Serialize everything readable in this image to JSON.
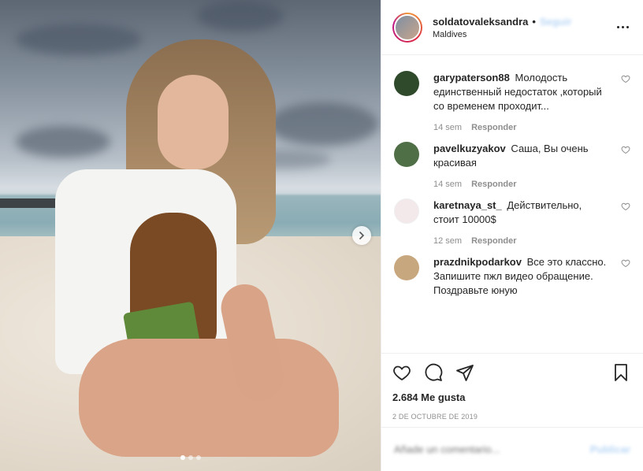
{
  "post": {
    "username": "soldatovaleksandra",
    "separator": "•",
    "follow_label": "Seguir",
    "location": "Maldives"
  },
  "comments": [
    {
      "user": "garypaterson88",
      "text": "Молодость единственный недостаток ,который со временем проходит...",
      "time": "14 sem",
      "reply": "Responder",
      "avatar_color": "#2f4a2b"
    },
    {
      "user": "pavelkuzyakov",
      "text": "Саша, Вы очень красивая",
      "time": "14 sem",
      "reply": "Responder",
      "avatar_color": "#4f6f46"
    },
    {
      "user": "karetnaya_st_",
      "text": "Действительно, стоит 10000$",
      "time": "12 sem",
      "reply": "Responder",
      "avatar_color": "#f3e9ea"
    },
    {
      "user": "prazdnikpodarkov",
      "text": "Все это классно. Запишите пжл видео обращение. Поздравьте юную",
      "time": "",
      "reply": "",
      "avatar_color": "#c7a77e"
    }
  ],
  "actions": {
    "like_icon": "heart-icon",
    "comment_icon": "comment-icon",
    "share_icon": "share-icon",
    "save_icon": "bookmark-icon",
    "likes_text": "2.684 Me gusta",
    "date": "2 DE OCTUBRE DE 2019"
  },
  "add_comment": {
    "placeholder": "Añade un comentario...",
    "publish_label": "Publicar"
  },
  "carousel": {
    "dot_count": 3,
    "active_index": 0
  }
}
